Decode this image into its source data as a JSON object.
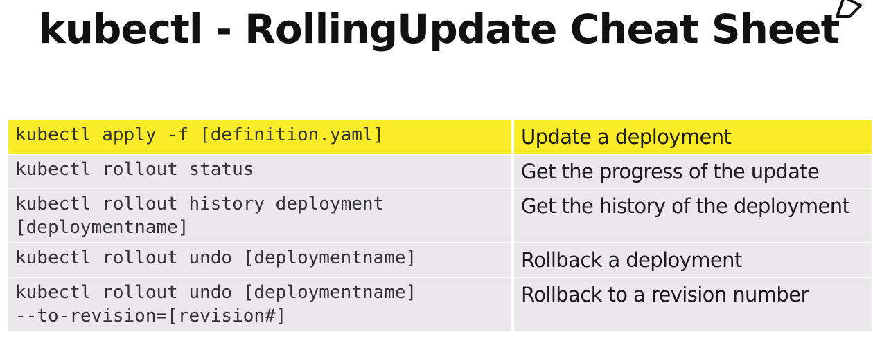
{
  "title": "kubectl - RollingUpdate Cheat Sheet",
  "highlight_color": "#fbec2a",
  "row_background": "#ebe8ec",
  "rows": [
    {
      "command": "kubectl apply -f [definition.yaml]",
      "description": "Update a deployment",
      "highlighted": true
    },
    {
      "command": "kubectl rollout status",
      "description": "Get the progress of the update",
      "highlighted": false
    },
    {
      "command": "kubectl rollout history deployment\n[deploymentname]",
      "description": "Get the history of the deployment",
      "highlighted": false
    },
    {
      "command": "kubectl rollout undo [deploymentname]",
      "description": "Rollback a deployment",
      "highlighted": false
    },
    {
      "command": "kubectl rollout undo [deploymentname]\n--to-revision=[revision#]",
      "description": "Rollback to a revision number",
      "highlighted": false
    }
  ]
}
